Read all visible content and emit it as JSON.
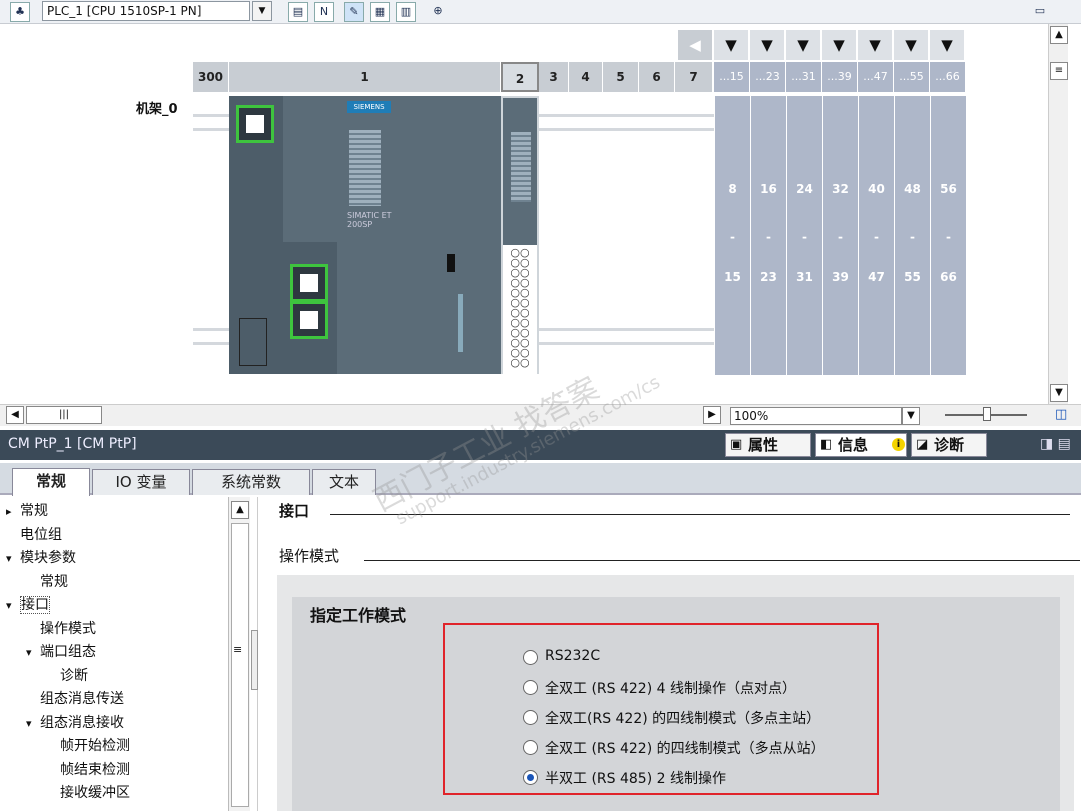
{
  "toolbar": {
    "device_select": "PLC_1 [CPU 1510SP-1 PN]",
    "icons": [
      "device-icon",
      "network-icon",
      "name-icon",
      "edit-icon",
      "table-icon",
      "panel-icon",
      "zoom-icon"
    ]
  },
  "rack": {
    "name": "机架_0",
    "slots": [
      "300",
      "1",
      "2",
      "3",
      "4",
      "5",
      "6",
      "7"
    ],
    "group_slots": [
      "...15",
      "...23",
      "...31",
      "...39",
      "...47",
      "...55",
      "...66"
    ],
    "group_top": [
      "8",
      "16",
      "24",
      "32",
      "40",
      "48",
      "56"
    ],
    "group_dash": [
      "-",
      "-",
      "-",
      "-",
      "-",
      "-",
      "-"
    ],
    "group_bottom": [
      "15",
      "23",
      "31",
      "39",
      "47",
      "55",
      "66"
    ],
    "module_text": {
      "brand": "SIEMENS",
      "model": "SIMATIC ET 200SP"
    }
  },
  "zoom": {
    "value": "100%"
  },
  "inspector": {
    "title": "CM PtP_1 [CM PtP]",
    "tab_properties": "属性",
    "tab_info": "信息",
    "tab_diagnostics": "诊断"
  },
  "tabs": [
    "常规",
    "IO 变量",
    "系统常数",
    "文本"
  ],
  "tree": [
    {
      "label": "常规",
      "indent": 0,
      "arrow": "▸"
    },
    {
      "label": "电位组",
      "indent": 0,
      "arrow": ""
    },
    {
      "label": "模块参数",
      "indent": 0,
      "arrow": "▾"
    },
    {
      "label": "常规",
      "indent": 1,
      "arrow": ""
    },
    {
      "label": "接口",
      "indent": 0,
      "arrow": "▾"
    },
    {
      "label": "操作模式",
      "indent": 1,
      "arrow": ""
    },
    {
      "label": "端口组态",
      "indent": 1,
      "arrow": "▾"
    },
    {
      "label": "诊断",
      "indent": 2,
      "arrow": ""
    },
    {
      "label": "组态消息传送",
      "indent": 1,
      "arrow": ""
    },
    {
      "label": "组态消息接收",
      "indent": 1,
      "arrow": "▾"
    },
    {
      "label": "帧开始检测",
      "indent": 2,
      "arrow": ""
    },
    {
      "label": "帧结束检测",
      "indent": 2,
      "arrow": ""
    },
    {
      "label": "接收缓冲区",
      "indent": 2,
      "arrow": ""
    }
  ],
  "content": {
    "section_interface": "接口",
    "section_opmode": "操作模式",
    "mode_title": "指定工作模式",
    "options": [
      {
        "label": "RS232C",
        "selected": false
      },
      {
        "label": "全双工 (RS 422) 4 线制操作（点对点）",
        "selected": false
      },
      {
        "label": "全双工(RS 422) 的四线制模式（多点主站）",
        "selected": false
      },
      {
        "label": "全双工 (RS 422) 的四线制模式（多点从站）",
        "selected": false
      },
      {
        "label": "半双工 (RS 485) 2 线制操作",
        "selected": true
      }
    ]
  },
  "colors": {
    "accent": "#1a55b8",
    "highlight_box": "#e0242a",
    "inspector_bar": "#3b4a58",
    "slot_group": "#aeb7c9"
  }
}
